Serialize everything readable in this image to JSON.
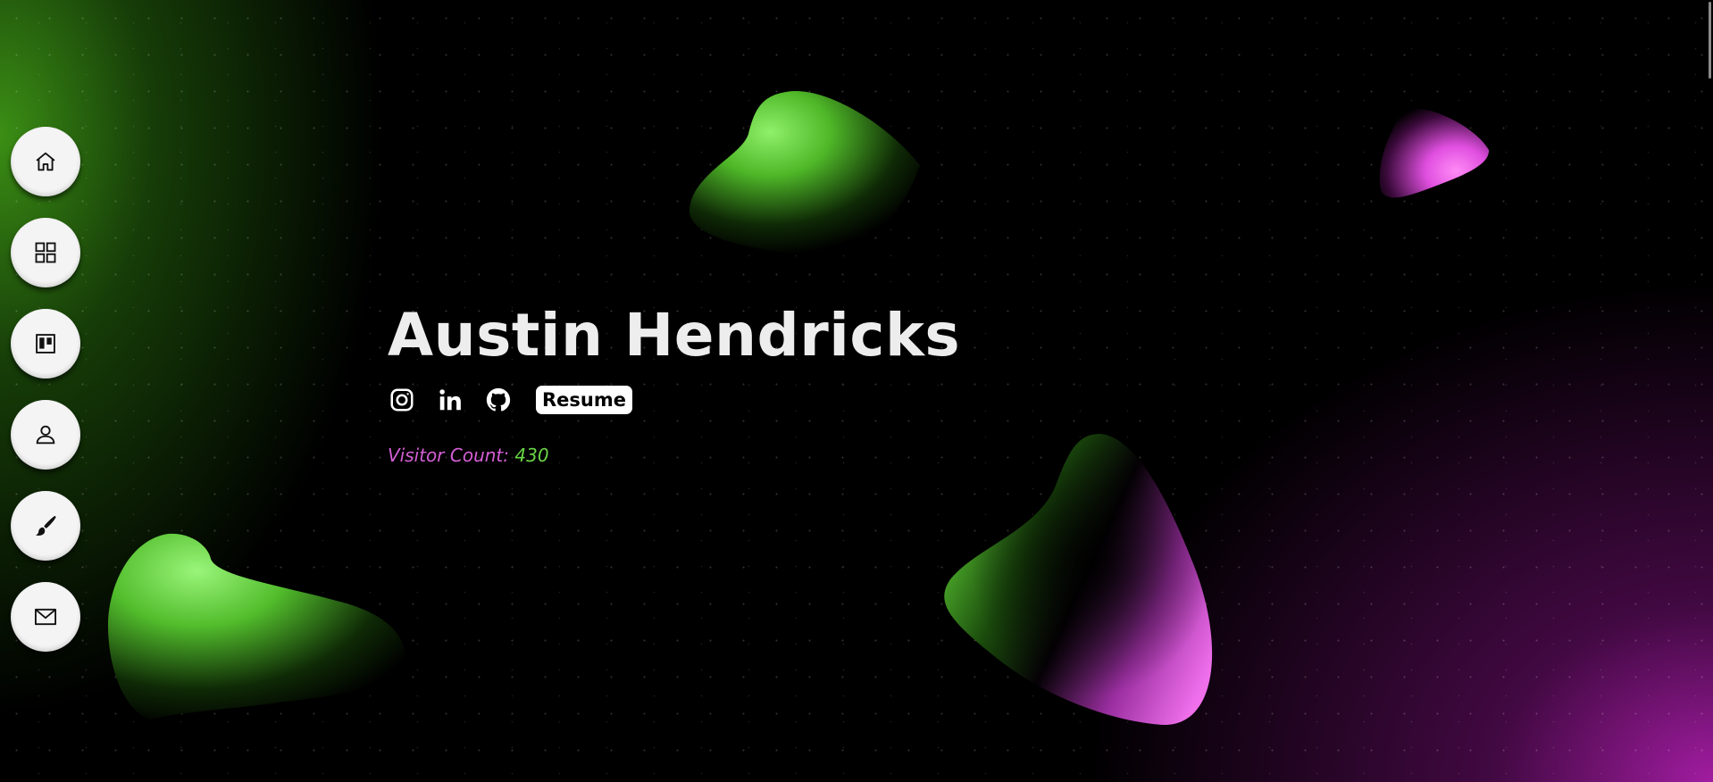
{
  "profile": {
    "name": "Austin Hendricks",
    "resume_label": "Resume",
    "visitor_label": "Visitor Count:",
    "visitor_count": "430"
  },
  "nav": {
    "items": [
      {
        "icon": "home-icon"
      },
      {
        "icon": "grid-icon"
      },
      {
        "icon": "board-icon"
      },
      {
        "icon": "user-icon"
      },
      {
        "icon": "brush-icon"
      },
      {
        "icon": "mail-icon"
      }
    ]
  },
  "socials": [
    {
      "icon": "instagram-icon"
    },
    {
      "icon": "linkedin-icon"
    },
    {
      "icon": "github-icon"
    }
  ],
  "colors": {
    "background": "#000000",
    "green_accent": "#6ad446",
    "magenta_accent": "#d35fd6",
    "name_text": "#ededed"
  }
}
